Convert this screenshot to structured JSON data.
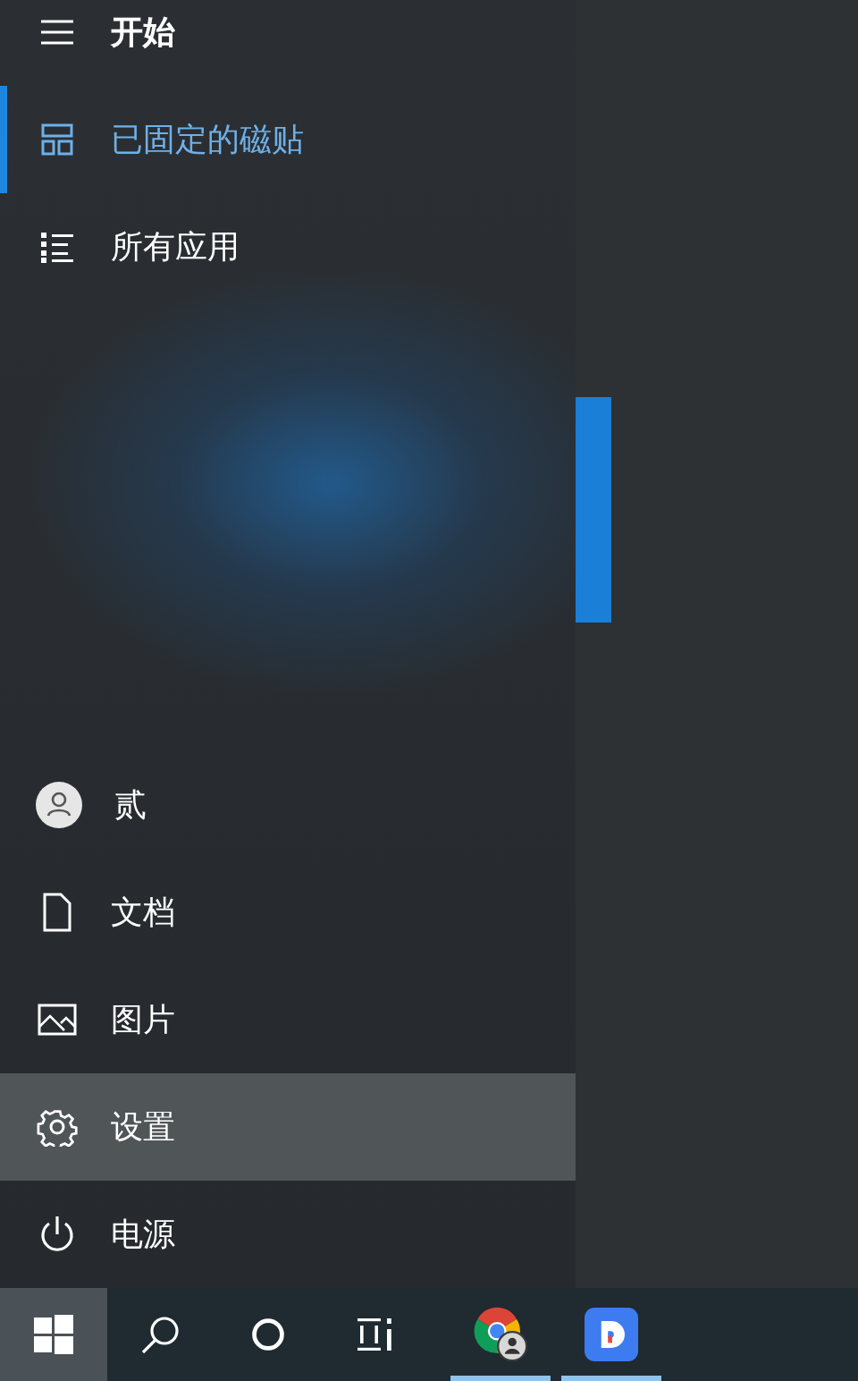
{
  "start_menu": {
    "header": {
      "label": "开始"
    },
    "nav_items": [
      {
        "label": "已固定的磁贴",
        "kind": "tiles",
        "selected": true
      },
      {
        "label": "所有应用",
        "kind": "list",
        "selected": false
      }
    ],
    "bottom_items": [
      {
        "label": "贰",
        "kind": "user",
        "highlighted": false
      },
      {
        "label": "文档",
        "kind": "document",
        "highlighted": false
      },
      {
        "label": "图片",
        "kind": "pictures",
        "highlighted": false
      },
      {
        "label": "设置",
        "kind": "settings",
        "highlighted": true
      },
      {
        "label": "电源",
        "kind": "power",
        "highlighted": false
      }
    ]
  },
  "taskbar": {
    "items": [
      {
        "kind": "start",
        "selected": true,
        "running": false
      },
      {
        "kind": "search",
        "selected": false,
        "running": false
      },
      {
        "kind": "cortana",
        "selected": false,
        "running": false
      },
      {
        "kind": "taskview",
        "selected": false,
        "running": false
      },
      {
        "kind": "browser",
        "selected": false,
        "running": true
      },
      {
        "kind": "app",
        "selected": false,
        "running": true
      }
    ]
  }
}
